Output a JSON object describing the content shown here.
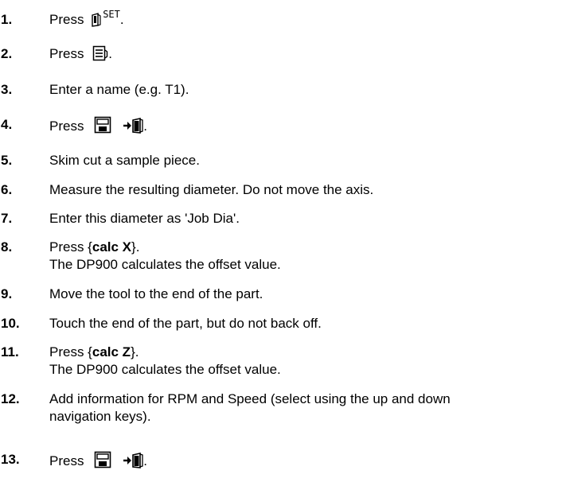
{
  "steps": [
    {
      "num": "1.",
      "text": "Press ",
      "sup": "SET",
      "suffix": "."
    },
    {
      "num": "2.",
      "text": "Press ",
      "suffix": "."
    },
    {
      "num": "3.",
      "text": "Enter a name (e.g. T1)."
    },
    {
      "num": "4.",
      "text": "Press ",
      "suffix": "."
    },
    {
      "num": "5.",
      "text": "Skim cut a sample piece."
    },
    {
      "num": "6.",
      "text": "Measure the resulting diameter. Do not move the axis."
    },
    {
      "num": "7.",
      "text": "Enter this diameter as 'Job Dia'."
    },
    {
      "num": "8.",
      "pre": "Press {",
      "cmd": "calc X",
      "post": "}.",
      "line2": "The DP900 calculates the offset value."
    },
    {
      "num": "9.",
      "text": "Move the tool to the end of the part."
    },
    {
      "num": "10.",
      "text": "Touch the end of the part, but do not back off."
    },
    {
      "num": "11.",
      "pre": "Press {",
      "cmd": "calc Z",
      "post": "}.",
      "line2": "The DP900 calculates the offset value."
    },
    {
      "num": "12.",
      "text": "Add information for RPM and Speed (select using the up and down",
      "line2": "navigation keys)."
    },
    {
      "num": "13.",
      "text": "Press ",
      "suffix": "."
    }
  ]
}
